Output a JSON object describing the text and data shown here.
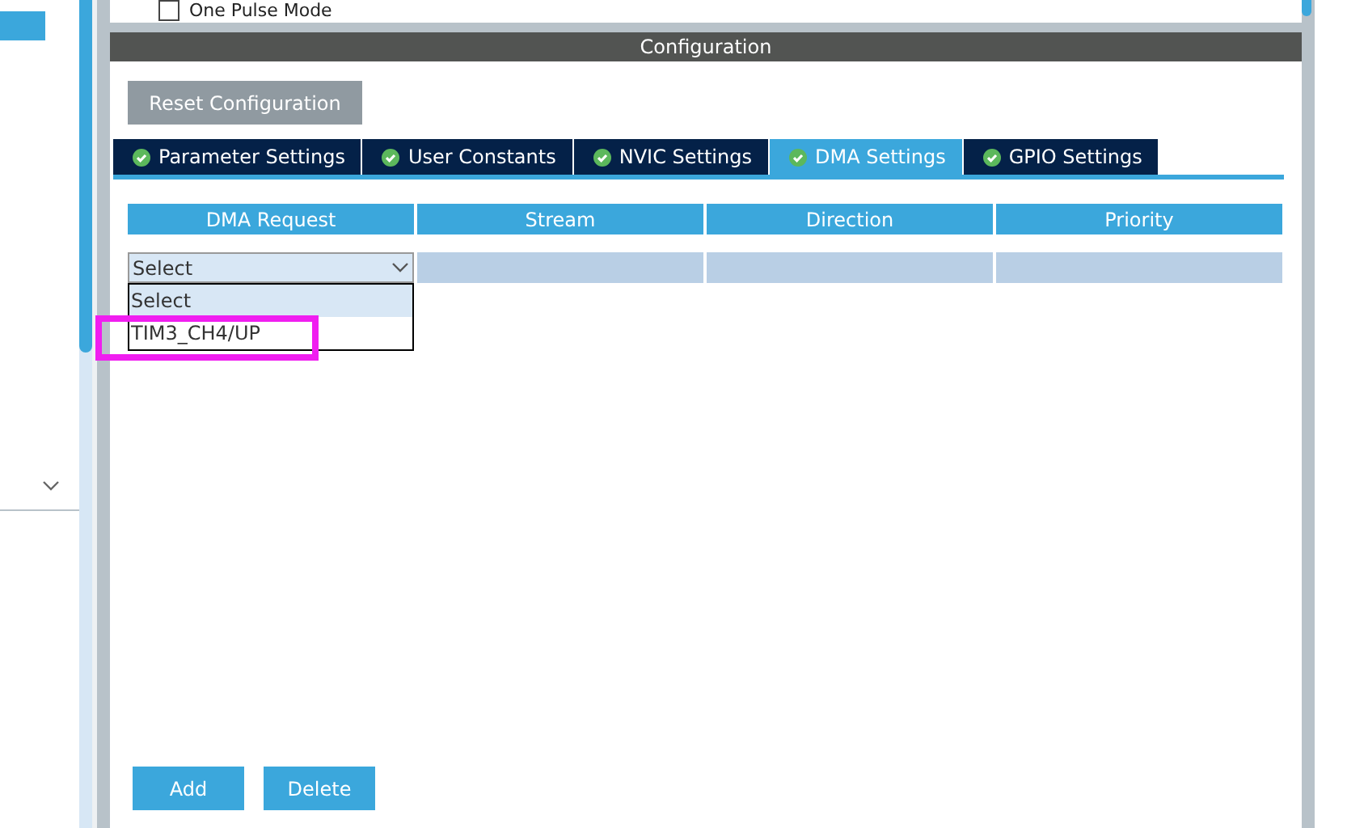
{
  "options_panel": {
    "checkbox": {
      "label": "One Pulse Mode",
      "checked": false
    }
  },
  "configuration": {
    "title": "Configuration",
    "reset_button": "Reset Configuration",
    "tabs": [
      {
        "label": "Parameter Settings",
        "selected": false
      },
      {
        "label": "User Constants",
        "selected": false
      },
      {
        "label": "NVIC Settings",
        "selected": false
      },
      {
        "label": "DMA Settings",
        "selected": true
      },
      {
        "label": "GPIO Settings",
        "selected": false
      }
    ],
    "table": {
      "columns": [
        "DMA Request",
        "Stream",
        "Direction",
        "Priority"
      ],
      "dropdown": {
        "value": "Select",
        "expanded": true,
        "options": [
          {
            "label": "Select",
            "selected": true,
            "highlighted": false
          },
          {
            "label": "TIM3_CH4/UP",
            "selected": false,
            "highlighted": true
          }
        ]
      }
    },
    "buttons": [
      "Add",
      "Delete"
    ]
  }
}
